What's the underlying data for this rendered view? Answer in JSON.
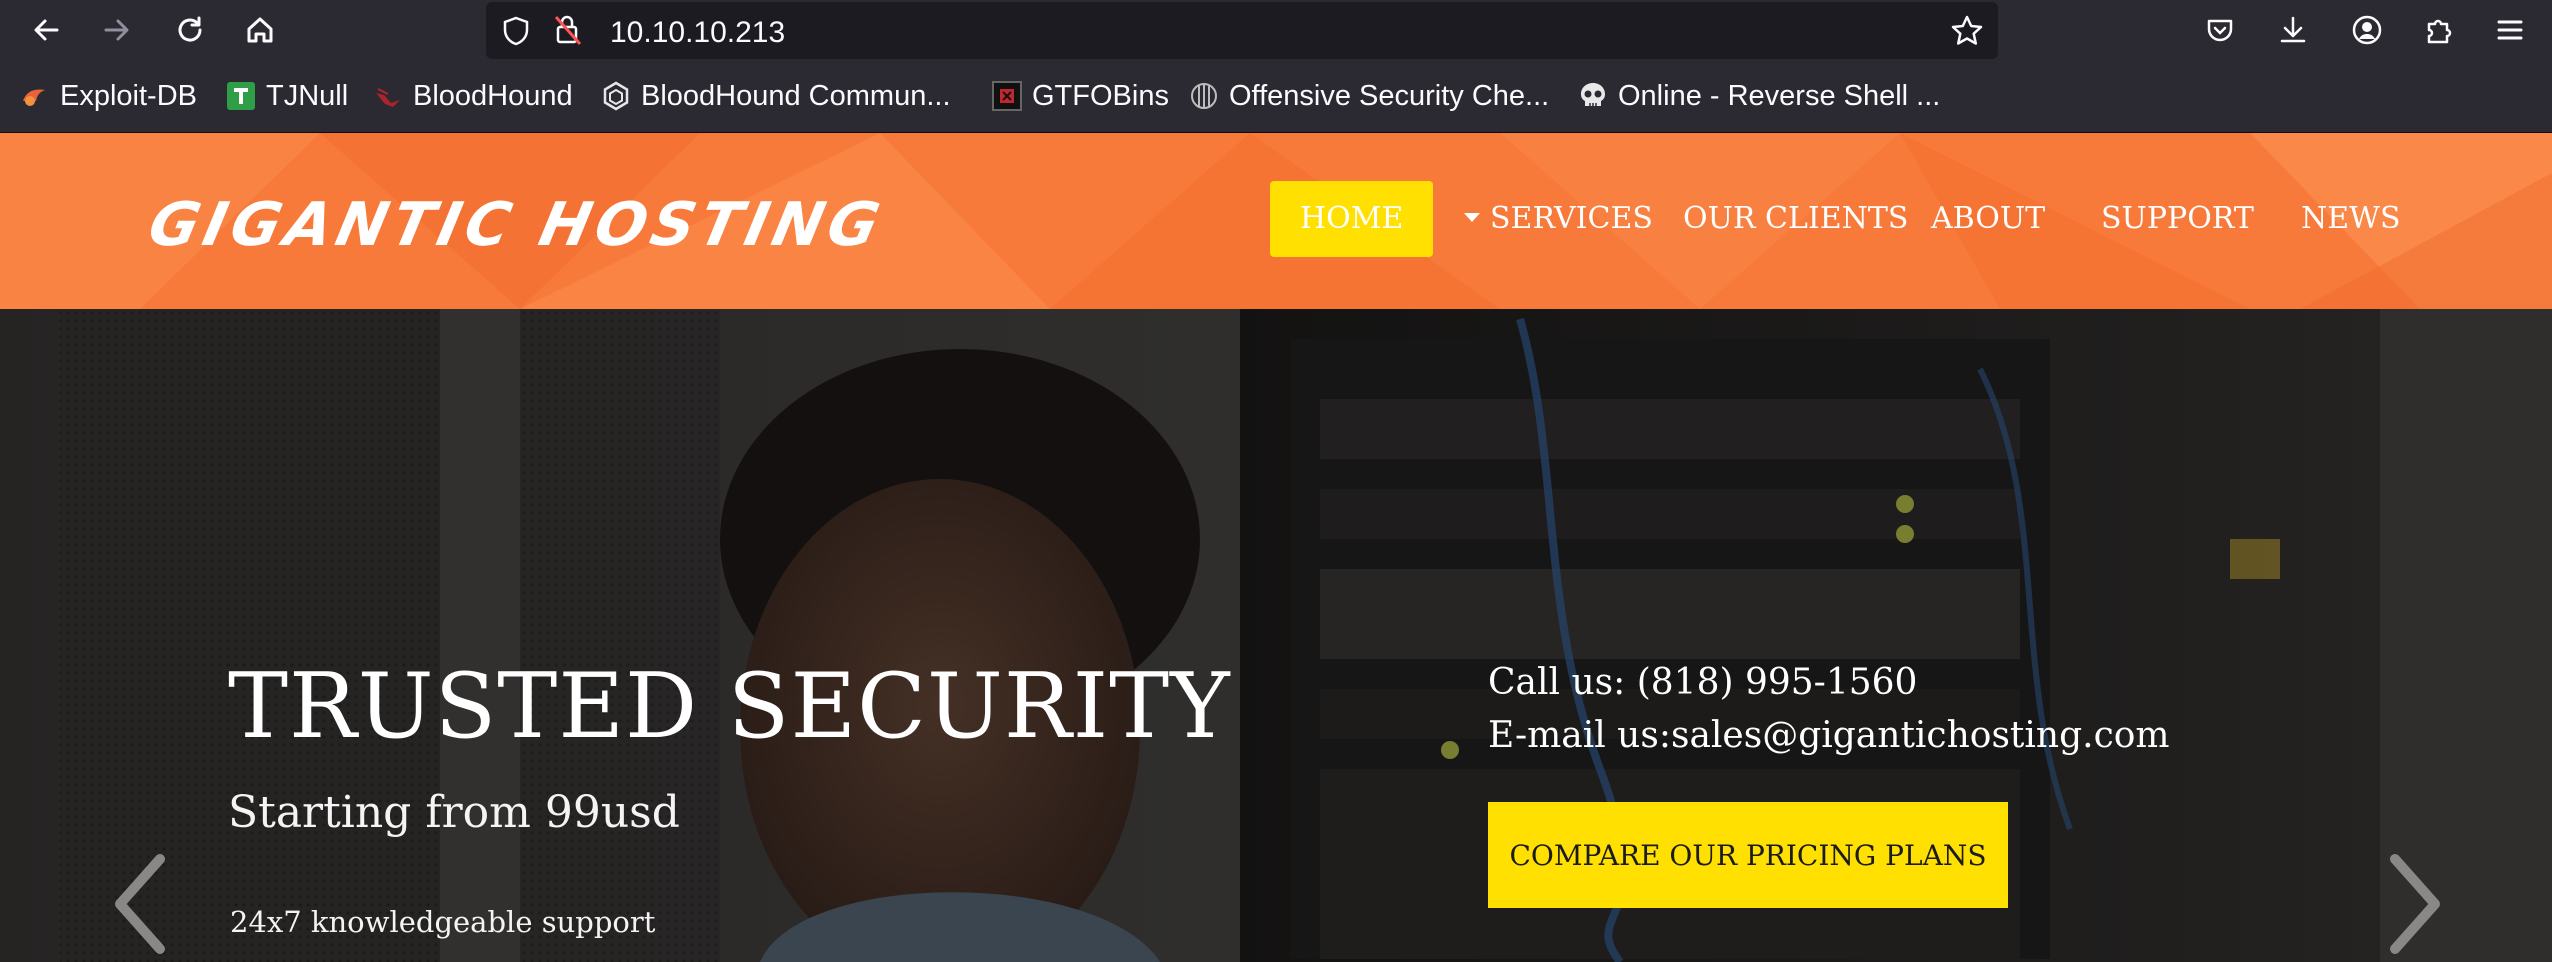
{
  "browser": {
    "url": "10.10.10.213",
    "bookmarks": [
      {
        "label": "Exploit-DB",
        "icon": "exploitdb-icon"
      },
      {
        "label": "TJNull",
        "icon": "tjnull-icon"
      },
      {
        "label": "BloodHound",
        "icon": "bloodhound-icon"
      },
      {
        "label": "BloodHound Commun...",
        "icon": "bloodhound-community-icon"
      },
      {
        "label": "GTFOBins",
        "icon": "gtfobins-icon"
      },
      {
        "label": "Offensive Security Che...",
        "icon": "offsec-icon"
      },
      {
        "label": "Online - Reverse Shell ...",
        "icon": "skull-icon"
      }
    ]
  },
  "site": {
    "logo": "GIGANTIC HOSTING",
    "nav": {
      "home": "HOME",
      "services": "SERVICES",
      "clients": "OUR CLIENTS",
      "about": "ABOUT",
      "support": "SUPPORT",
      "news": "NEWS"
    },
    "hero": {
      "title": "TRUSTED SECURITY",
      "subtitle": "Starting from 99usd",
      "support": "24x7 knowledgeable support",
      "call": "Call us: (818) 995-1560",
      "email": "E-mail us:sales@gigantichosting.com",
      "cta": "COMPARE OUR PRICING PLANS"
    }
  },
  "colors": {
    "header_orange": "#f77a3a",
    "accent_yellow": "#ffe000",
    "browser_bg": "#2b2a33"
  }
}
